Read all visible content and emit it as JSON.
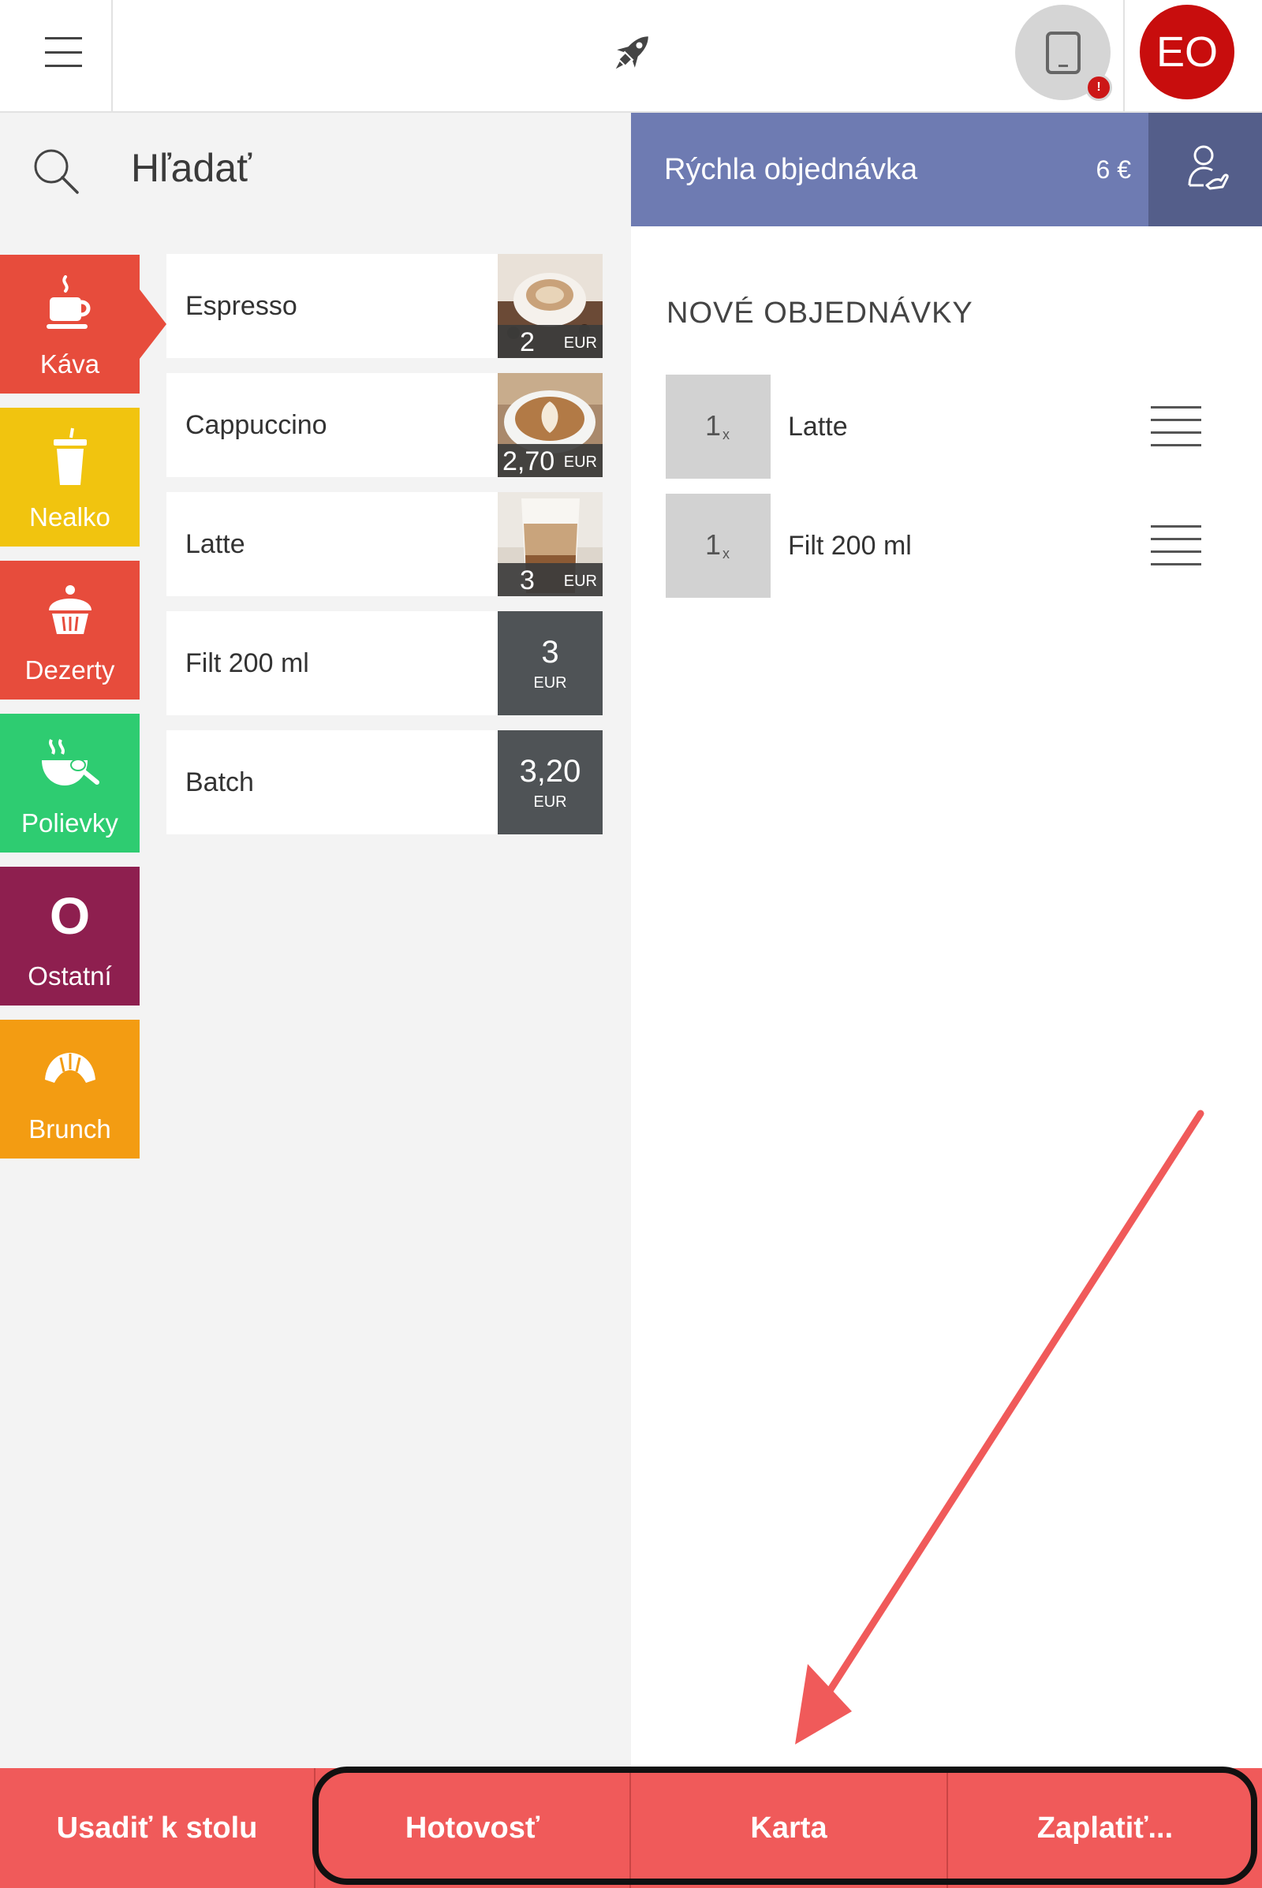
{
  "topbar": {
    "avatar_initials": "EO",
    "device_alert": "!",
    "icons": [
      "hamburger-menu-icon",
      "rocket-icon",
      "tablet-icon",
      "user-avatar"
    ]
  },
  "search": {
    "label": "Hľadať",
    "icon": "search-icon"
  },
  "categories": [
    {
      "label": "Káva",
      "icon": "coffee-cup-icon",
      "color": "#e74c3c",
      "active": true
    },
    {
      "label": "Nealko",
      "icon": "drink-cup-icon",
      "color": "#f1c40f"
    },
    {
      "label": "Dezerty",
      "icon": "cupcake-icon",
      "color": "#e74c3c"
    },
    {
      "label": "Polievky",
      "icon": "soup-bowl-icon",
      "color": "#2ecc71"
    },
    {
      "label": "Ostatní",
      "icon_text": "O",
      "color": "#8e1f4f"
    },
    {
      "label": "Brunch",
      "icon": "croissant-icon",
      "color": "#f39c12"
    }
  ],
  "products": [
    {
      "name": "Espresso",
      "price": "2",
      "currency": "EUR",
      "photo": "espresso"
    },
    {
      "name": "Cappuccino",
      "price": "2,70",
      "currency": "EUR",
      "photo": "cappuccino"
    },
    {
      "name": "Latte",
      "price": "3",
      "currency": "EUR",
      "photo": "latte"
    },
    {
      "name": "Filt 200 ml",
      "price": "3",
      "currency": "EUR"
    },
    {
      "name": "Batch",
      "price": "3,20",
      "currency": "EUR"
    }
  ],
  "order": {
    "title": "Rýchla objednávka",
    "total": "6 €",
    "section_title": "NOVÉ OBJEDNÁVKY",
    "items": [
      {
        "qty": "1",
        "qty_suffix": "x",
        "name": "Latte"
      },
      {
        "qty": "1",
        "qty_suffix": "x",
        "name": "Filt 200 ml"
      }
    ]
  },
  "bottom": {
    "seat": "Usadiť k stolu",
    "cash": "Hotovosť",
    "card": "Karta",
    "pay": "Zaplatiť..."
  },
  "colors": {
    "accent_header": "#6e7bb2",
    "bottom_bar": "#f05a5a",
    "annotation_arrow": "#f05a5a",
    "avatar": "#c80d0d"
  }
}
